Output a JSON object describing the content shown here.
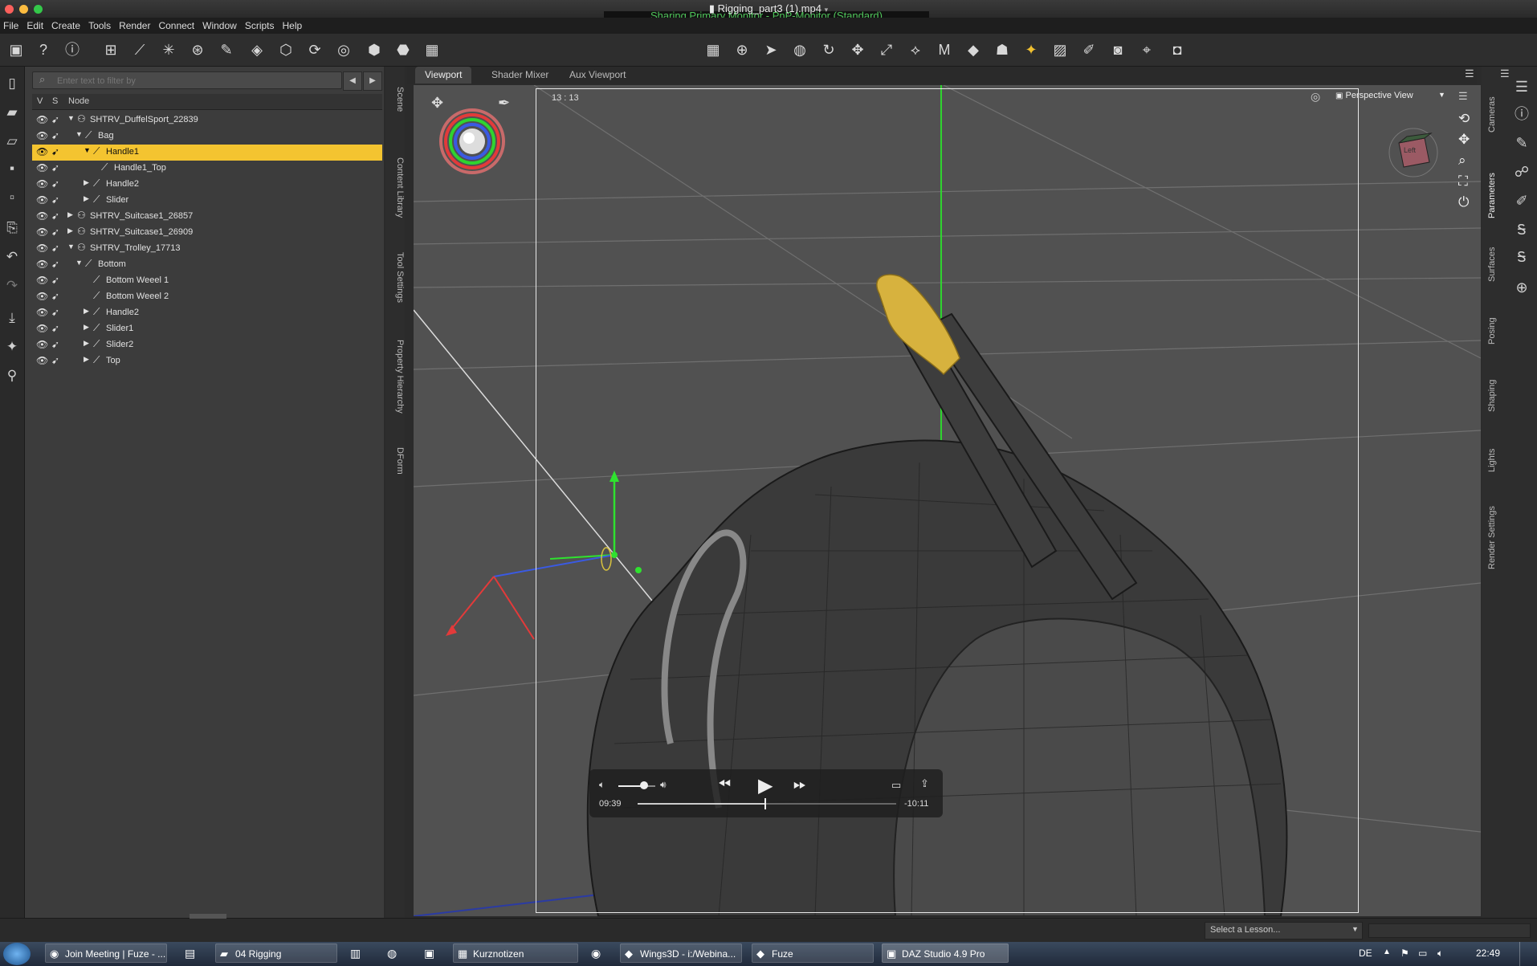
{
  "window": {
    "title": "Rigging_part3 (1).mp4",
    "share_banner": "Sharing Primary Monitor - PnP-Monitor (Standard)"
  },
  "menu": [
    "File",
    "Edit",
    "Create",
    "Tools",
    "Render",
    "Connect",
    "Window",
    "Scripts",
    "Help"
  ],
  "scene": {
    "filter_placeholder": "Enter text to filter by",
    "columns": {
      "v": "V",
      "s": "S",
      "node": "Node"
    },
    "nodes": [
      {
        "name": "SHTRV_DuffelSport_22839",
        "depth": 0,
        "expanded": true,
        "kind": "figure",
        "selected": false
      },
      {
        "name": "Bag",
        "depth": 1,
        "expanded": true,
        "kind": "bone",
        "selected": false
      },
      {
        "name": "Handle1",
        "depth": 2,
        "expanded": true,
        "kind": "bone",
        "selected": true
      },
      {
        "name": "Handle1_Top",
        "depth": 3,
        "expanded": false,
        "kind": "bone",
        "selected": false
      },
      {
        "name": "Handle2",
        "depth": 2,
        "expanded": false,
        "kind": "bone",
        "selected": false
      },
      {
        "name": "Slider",
        "depth": 2,
        "expanded": false,
        "kind": "bone",
        "selected": false
      },
      {
        "name": "SHTRV_Suitcase1_26857",
        "depth": 0,
        "expanded": false,
        "kind": "figure",
        "selected": false
      },
      {
        "name": "SHTRV_Suitcase1_26909",
        "depth": 0,
        "expanded": false,
        "kind": "figure",
        "selected": false
      },
      {
        "name": "SHTRV_Trolley_17713",
        "depth": 0,
        "expanded": true,
        "kind": "figure",
        "selected": false
      },
      {
        "name": "Bottom",
        "depth": 1,
        "expanded": true,
        "kind": "bone",
        "selected": false
      },
      {
        "name": "Bottom Weeel 1",
        "depth": 2,
        "expanded": false,
        "kind": "bone",
        "selected": false
      },
      {
        "name": "Bottom Weeel 2",
        "depth": 2,
        "expanded": false,
        "kind": "bone",
        "selected": false
      },
      {
        "name": "Handle2",
        "depth": 2,
        "expanded": false,
        "kind": "bone",
        "selected": false
      },
      {
        "name": "Slider1",
        "depth": 2,
        "expanded": false,
        "kind": "bone",
        "selected": false
      },
      {
        "name": "Slider2",
        "depth": 2,
        "expanded": false,
        "kind": "bone",
        "selected": false
      },
      {
        "name": "Top",
        "depth": 2,
        "expanded": false,
        "kind": "bone",
        "selected": false
      }
    ]
  },
  "left_side_tabs": [
    "Scene",
    "Content Library",
    "Tool Settings",
    "Property Hierarchy",
    "DForm"
  ],
  "viewport_tabs": [
    "Viewport",
    "Shader Mixer",
    "Aux Viewport"
  ],
  "viewport": {
    "timecode": "13 : 13",
    "view_mode": "Perspective View",
    "nav_cube_label": "Left"
  },
  "right_side_tabs": [
    "Cameras",
    "Parameters",
    "Surfaces",
    "Posing",
    "Shaping",
    "Lights",
    "Render Settings"
  ],
  "player": {
    "elapsed": "09:39",
    "remaining": "-10:11",
    "progress": 0.49,
    "volume": 0.7
  },
  "lesson_select": "Select a Lesson...",
  "taskbar": {
    "tasks": [
      "Join Meeting | Fuze - ...",
      "04 Rigging",
      "Kurznotizen",
      "Wings3D - i:/Webina...",
      "Fuze",
      "DAZ Studio 4.9 Pro"
    ],
    "language": "DE",
    "clock": "22:49"
  },
  "colors": {
    "selection": "#f4c430",
    "gizmo_red": "#e33a3a",
    "gizmo_green": "#3ad13a",
    "gizmo_blue": "#3a5ae3"
  }
}
